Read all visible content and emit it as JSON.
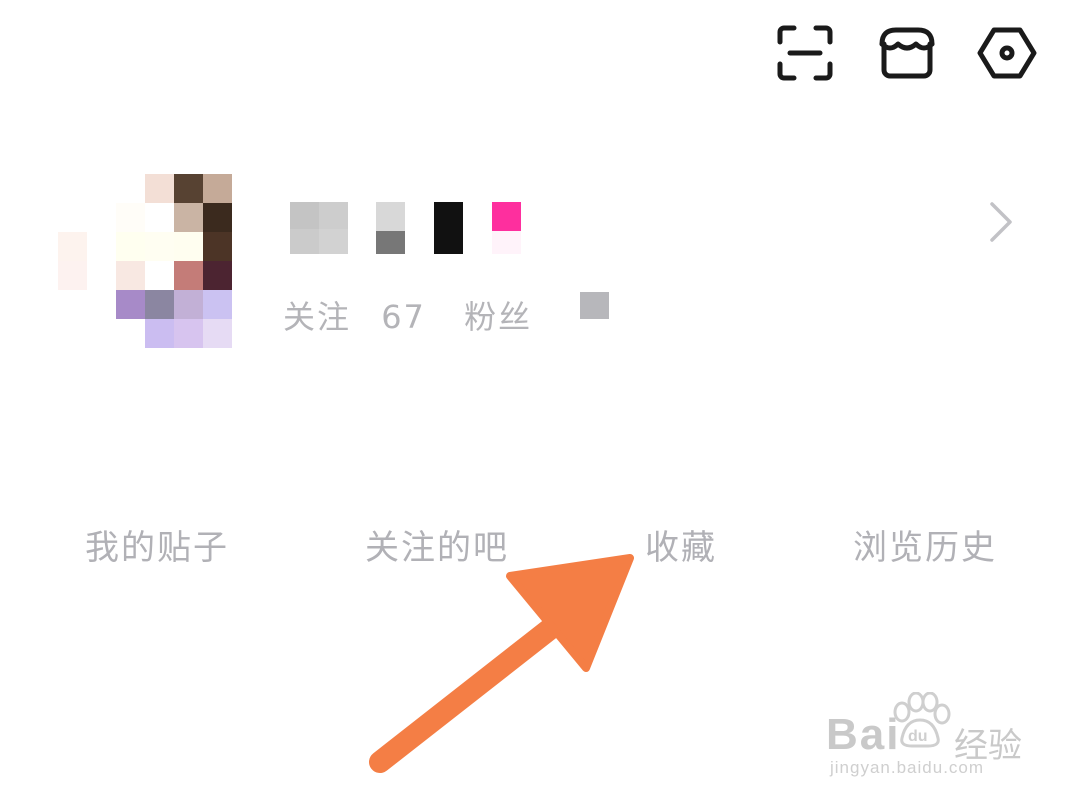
{
  "topbar": {
    "icons": [
      "scan-icon",
      "store-icon",
      "settings-icon"
    ]
  },
  "profile": {
    "stats": {
      "following_label": "关注",
      "following_count": "67",
      "fans_label": "粉丝"
    },
    "chevron_icon": "chevron-right-icon"
  },
  "tabs": [
    {
      "label": "我的贴子"
    },
    {
      "label": "关注的吧"
    },
    {
      "label": "收藏"
    },
    {
      "label": "浏览历史"
    }
  ],
  "annotation": {
    "arrow_color": "#f47e45",
    "points_to": "收藏"
  },
  "watermark": {
    "brand": "Bai",
    "brand_du": "du",
    "brand_cn": "经验",
    "url": "jingyan.baidu.com"
  },
  "colors": {
    "text_muted": "#b1b1b6",
    "arrow": "#f47e45",
    "icon": "#1a1a1a"
  }
}
